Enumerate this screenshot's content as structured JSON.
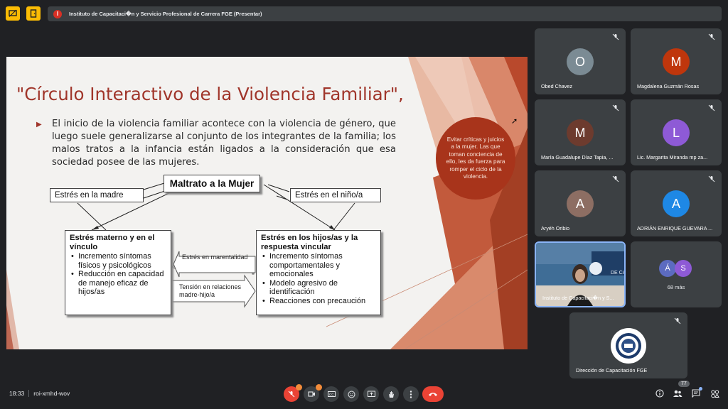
{
  "topbar": {
    "presentation_title": "Instituto de Capacitaci�n y Servicio Profesional de Carrera FGE (Presentar)",
    "presenter_initial": "I"
  },
  "slide": {
    "title": "\"Círculo Interactivo de la Violencia Familiar\",",
    "bullet": "El inicio de la violencia familiar acontece con la violencia de género, que luego suele generalizarse al conjunto de los integrantes de la familia; los malos tratos a la infancia están ligados a la consideración que esa sociedad posee de las mujeres.",
    "center_box": "Maltrato a la Mujer",
    "left_label": "Estrés en la madre",
    "right_label": "Estrés en el niño/a",
    "left_block": {
      "heading": "Estrés materno y en el vínculo",
      "items": [
        "Incremento síntomas físicos y psicológicos",
        "Reducción en capacidad de manejo eficaz de hijos/as"
      ]
    },
    "right_block": {
      "heading": "Estrés en los hijos/as y la respuesta vincular",
      "items": [
        "Incremento síntomas comportamentales y emocionales",
        "Modelo agresivo de identificación",
        "Reacciones con precaución"
      ]
    },
    "arrow_left_label": "Estrés en marentalidad",
    "arrow_right_label": "Tensión en relaciones madre-hijo/a",
    "circle_note": "Evitar críticas y juicios a la mujer. Las que toman conciencia de ello, les da fuerza para romper el ciclo de la violencia."
  },
  "participants": [
    {
      "name": "Obed Chavez",
      "initial": "O",
      "color": "#7b8b94"
    },
    {
      "name": "Magdalena Guzmán Rosas",
      "initial": "M",
      "color": "#bf360c"
    },
    {
      "name": "María Guadalupe Díaz Tapia, ...",
      "initial": "M",
      "color": "#6d3b2e"
    },
    {
      "name": "Lic. Margarita Miranda mp za...",
      "initial": "L",
      "color": "#8e5ad6"
    },
    {
      "name": "Aryéh Oribio",
      "initial": "A",
      "color": "#8d6e63"
    },
    {
      "name": "ADRIÁN ENRIQUE GUEVARA ...",
      "initial": "A",
      "color": "#1e88e5"
    },
    {
      "name": "Instituto de Capacitaci�n y S...",
      "initial": "",
      "color": ""
    },
    {
      "name": "68 más",
      "initial": "",
      "color": ""
    },
    {
      "name": "Dirección de Capacitación FGE",
      "initial": "",
      "color": ""
    }
  ],
  "more_tile": {
    "initial_a": "Á",
    "initial_b": "S",
    "label": "68 más",
    "color_a": "#5c6bc0",
    "color_b": "#8e5ad6"
  },
  "bottom": {
    "time": "18:33",
    "meeting_code": "roi-xmhd-wov",
    "participant_count": "77"
  }
}
